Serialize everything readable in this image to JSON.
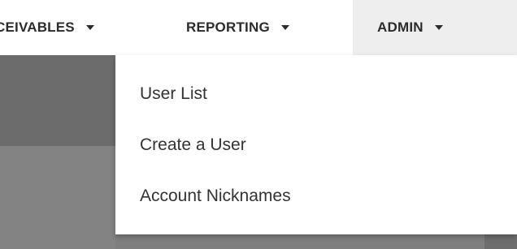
{
  "nav": {
    "items": [
      {
        "label": "CEIVABLES"
      },
      {
        "label": "REPORTING"
      },
      {
        "label": "ADMIN"
      }
    ]
  },
  "admin_menu": {
    "items": [
      {
        "label": "User List"
      },
      {
        "label": "Create a User"
      },
      {
        "label": "Account Nicknames"
      }
    ]
  },
  "colors": {
    "active_tab_bg": "#eeeeee",
    "overlay": "#7f7f7f",
    "text": "#2b2b2b"
  }
}
